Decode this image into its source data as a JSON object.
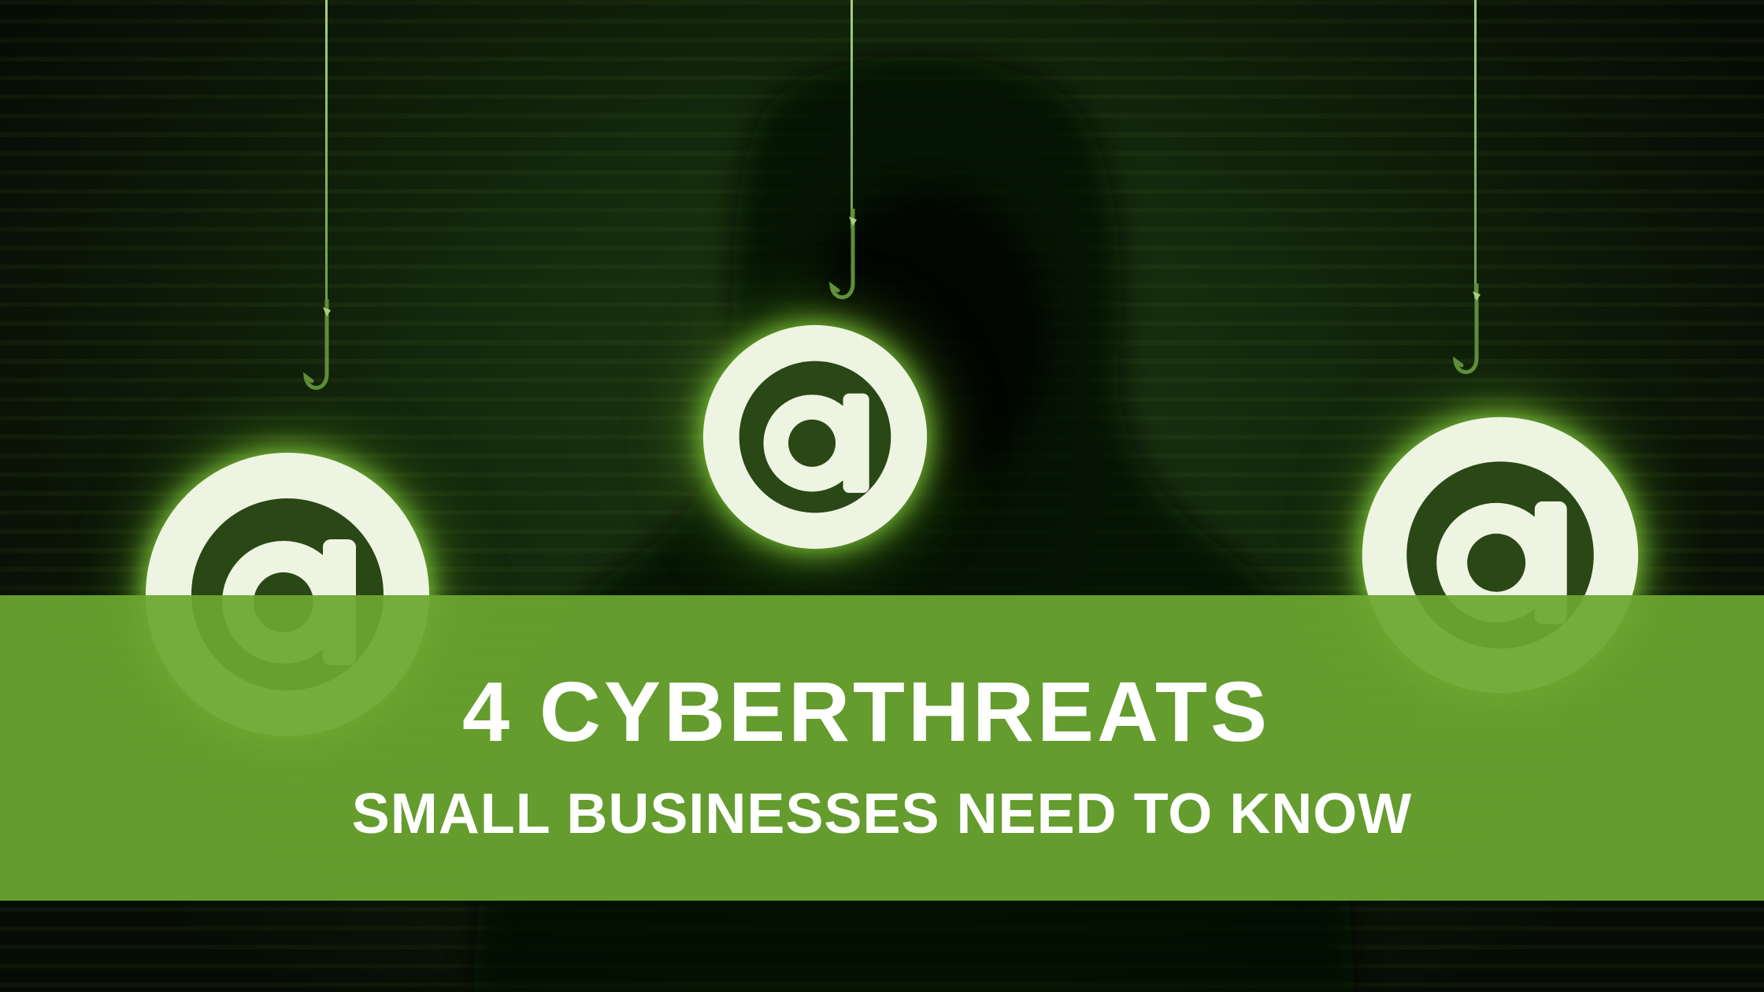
{
  "banner": {
    "headline": "4 CYBERTHREATS",
    "subline": "SMALL BUSINESSES NEED TO KNOW"
  },
  "illustration": {
    "icons": [
      "at-sign-icon",
      "at-sign-icon",
      "at-sign-icon",
      "fishing-hook-icon"
    ],
    "colors": {
      "background_dark": "#0b1708",
      "glow_green": "#96e646",
      "banner_green": "#6ca730",
      "text": "#ffffff"
    }
  }
}
